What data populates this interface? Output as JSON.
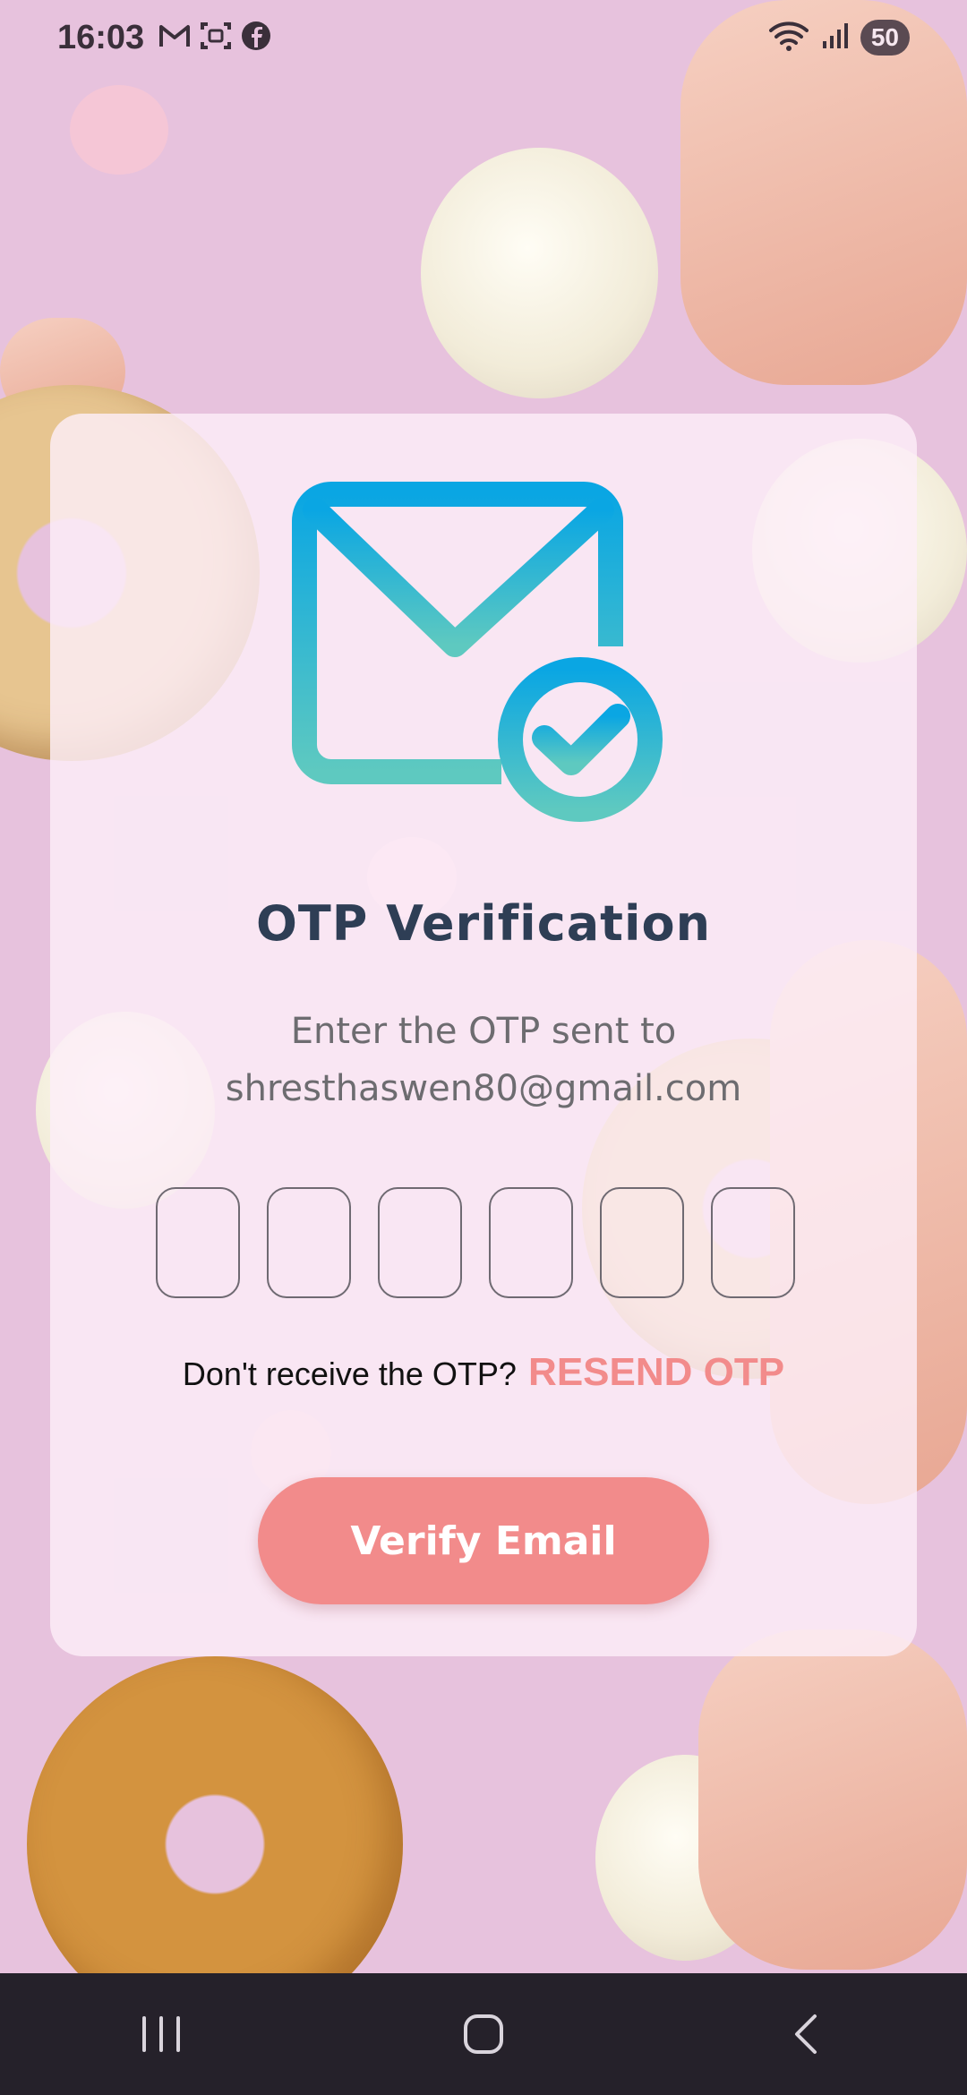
{
  "status_bar": {
    "time": "16:03",
    "left_icons": [
      "gmail-icon",
      "screenshot-icon",
      "facebook-icon"
    ],
    "right_icons": [
      "wifi-icon",
      "signal-icon"
    ],
    "battery": "50"
  },
  "card": {
    "icon": "mail-verified-icon",
    "title": "OTP Verification",
    "subtitle_line1": "Enter the OTP sent to",
    "subtitle_line2": "shresthaswen80@gmail.com",
    "otp_digits": [
      "",
      "",
      "",
      "",
      "",
      ""
    ],
    "resend_question": "Don't receive the OTP?",
    "resend_link": "RESEND OTP",
    "verify_button": "Verify Email"
  },
  "nav_bar": {
    "buttons": [
      "recent-apps-icon",
      "home-icon",
      "back-icon"
    ]
  },
  "colors": {
    "background": "#e7c2dd",
    "card": "#fceef8",
    "title": "#2e3e55",
    "subtitle": "#6d6c70",
    "accent": "#f28b8b",
    "icon_gradient_top": "#0aa6e3",
    "icon_gradient_bottom": "#5ec9c0",
    "nav_bar": "#25212a"
  }
}
